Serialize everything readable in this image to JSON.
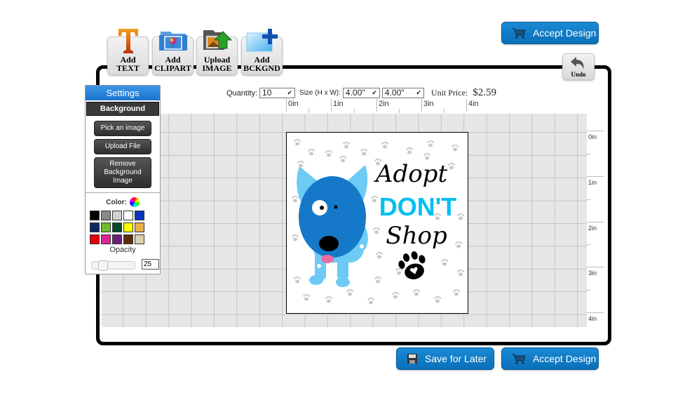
{
  "toolbar": {
    "tools": [
      {
        "line1": "Add",
        "line2": "TEXT",
        "icon": "text-T-icon"
      },
      {
        "line1": "Add",
        "line2": "CLIPART",
        "icon": "clipart-folder-icon"
      },
      {
        "line1": "Upload",
        "line2": "IMAGE",
        "icon": "upload-image-icon"
      },
      {
        "line1": "Add",
        "line2": "BCKGND",
        "icon": "add-background-icon"
      }
    ],
    "undo_label": "Undo",
    "accept_top_label": "Accept Design"
  },
  "options": {
    "quantity_label": "Quantity:",
    "quantity_value": "10",
    "size_label": "Size (H x W):",
    "height_value": "4.00\"",
    "width_value": "4.00\"",
    "unit_price_label": "Unit Price:",
    "unit_price_value": "$2.59"
  },
  "ruler": {
    "top": [
      "0in",
      "1in",
      "2in",
      "3in",
      "4in"
    ],
    "side": [
      "0in",
      "1in",
      "2in",
      "3in",
      "4in"
    ]
  },
  "settings": {
    "title": "Settings",
    "section": "Background",
    "buttons": {
      "pick": "Pick an image",
      "upload": "Upload File",
      "remove": "Remove Background Image"
    },
    "color_label": "Color:",
    "swatches": [
      "#000000",
      "#868a8e",
      "#cfd0d0",
      "#ffffff",
      "#0a36b8",
      "#0d2a64",
      "#6cbf2b",
      "#044a2d",
      "#ffff00",
      "#e8b04a",
      "#e00010",
      "#e02496",
      "#6d1f7e",
      "#5a2d12",
      "#ddd1b0"
    ],
    "opacity_label": "Opacity",
    "opacity_value": "25"
  },
  "design": {
    "line1": "Adopt",
    "line2": "DON'T",
    "line3": "Shop",
    "accent_color": "#00c0f0"
  },
  "footer": {
    "save_label": "Save for Later",
    "accept_label": "Accept Design"
  },
  "colors": {
    "primary_button": "#0a78c5",
    "settings_header": "#2b86dc"
  }
}
